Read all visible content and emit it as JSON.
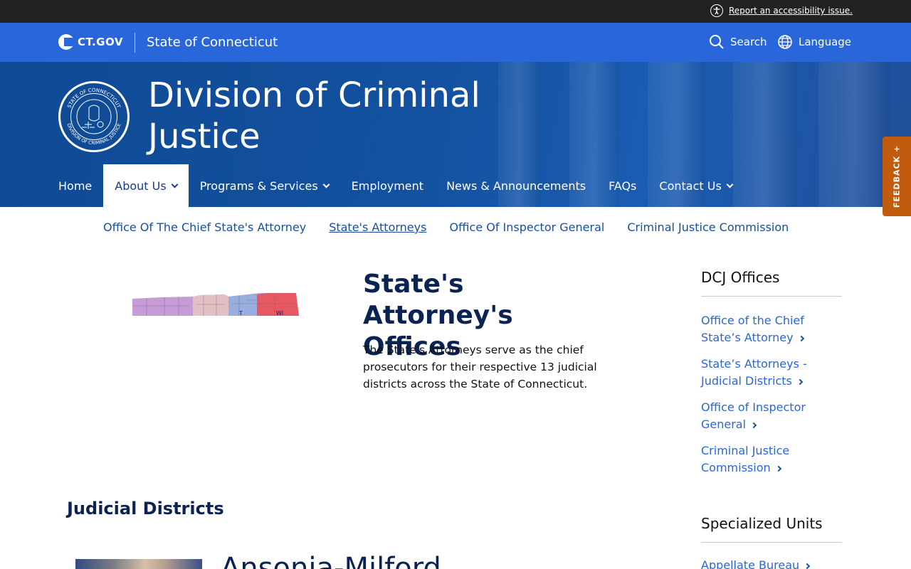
{
  "utility": {
    "accessibility_link": "Report an accessibility issue."
  },
  "header": {
    "logo_text": "CT.GOV",
    "state_name": "State of Connecticut",
    "search_label": "Search",
    "language_label": "Language"
  },
  "hero": {
    "title": "Division of Criminal Justice",
    "seal_text_top": "STATE OF CONNECTICUT",
    "seal_text_bottom": "DIVISION OF CRIMINAL JUSTICE"
  },
  "nav": {
    "items": [
      {
        "label": "Home"
      },
      {
        "label": "About Us"
      },
      {
        "label": "Programs & Services"
      },
      {
        "label": "Employment"
      },
      {
        "label": "News & Announcements"
      },
      {
        "label": "FAQs"
      },
      {
        "label": "Contact Us"
      }
    ]
  },
  "subnav": {
    "items": [
      {
        "label": "Office Of The Chief State's Attorney"
      },
      {
        "label": "State's Attorneys"
      },
      {
        "label": "Office Of Inspector General"
      },
      {
        "label": "Criminal Justice Commission"
      }
    ]
  },
  "map": {
    "labels": [
      "T",
      "WI"
    ]
  },
  "main": {
    "title": "State's Attorney's Offices",
    "intro": "The State's Attorneys serve as the chief prosecutors for their respective 13 judicial districts across the State of Connecticut.",
    "districts_heading": "Judicial Districts",
    "first_district_partial": "Ansonia-Milford"
  },
  "sidebar": {
    "offices_heading": "DCJ Offices",
    "offices": [
      {
        "label": "Office of the Chief State’s Attorney"
      },
      {
        "label": "State’s Attorneys - Judicial Districts"
      },
      {
        "label": "Office of Inspector General"
      },
      {
        "label": "Criminal Justice Commission"
      }
    ],
    "units_heading": "Specialized Units",
    "units": [
      {
        "label": "Appellate Bureau"
      }
    ]
  },
  "feedback": {
    "label": "FEEDBACK +"
  },
  "colors": {
    "top_bar": "#222222",
    "ct_bar": "#2966d9",
    "hero": "#13509e",
    "heading_navy": "#0b2353",
    "link_blue": "#2966d9",
    "feedback_orange": "#c25b0e"
  }
}
